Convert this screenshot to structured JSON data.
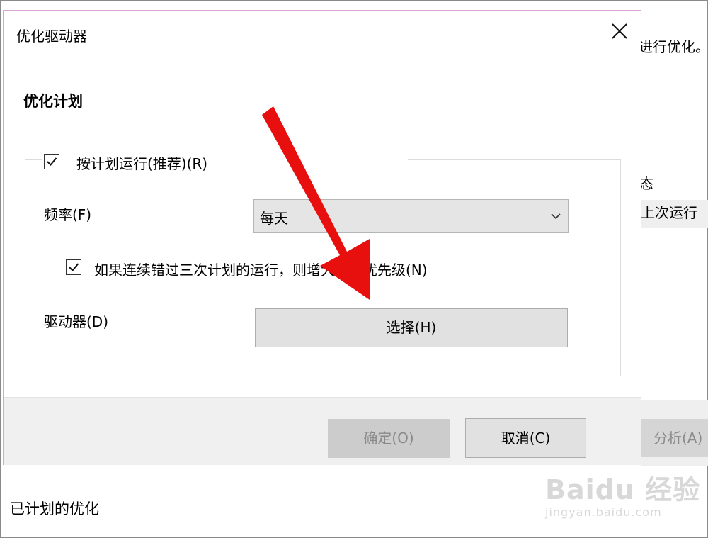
{
  "background_window": {
    "top_text": "进行优化。",
    "column_header": "态",
    "column_row": "上次运行",
    "analyze_button": "分析(A)",
    "scheduled_label": "已计划的优化"
  },
  "dialog": {
    "title": "优化驱动器",
    "section_title": "优化计划",
    "run_on_schedule": {
      "label": "按计划运行(推荐)(R)",
      "checked": true
    },
    "frequency": {
      "label": "频率(F)",
      "value": "每天"
    },
    "increase_priority": {
      "label": "如果连续错过三次计划的运行，则增大任务优先级(N)",
      "checked": true
    },
    "drives": {
      "label": "驱动器(D)",
      "button": "选择(H)"
    },
    "ok_button": "确定(O)",
    "cancel_button": "取消(C)"
  },
  "watermark": {
    "main": "Baidu 经验",
    "sub": "jingyan.baidu.com"
  },
  "colors": {
    "annotation_arrow": "#e8100f",
    "disabled_button": "#cccccc",
    "footer_bg": "#f0f0f0"
  }
}
